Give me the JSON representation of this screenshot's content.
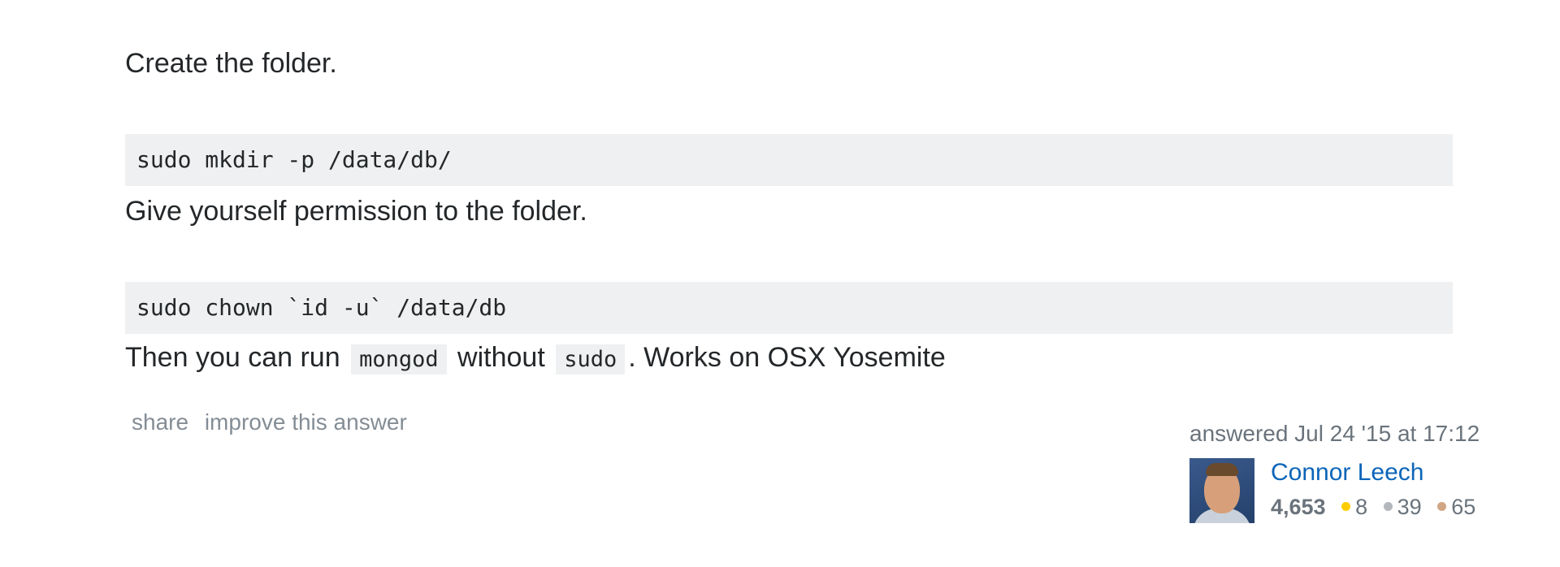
{
  "answer": {
    "paragraphs": {
      "p1": "Create the folder.",
      "p2": "Give yourself permission to the folder.",
      "p3_before": "Then you can run ",
      "p3_code1": "mongod",
      "p3_middle": " without ",
      "p3_code2": "sudo",
      "p3_after": ". Works on OSX Yosemite"
    },
    "code_blocks": {
      "block1": "sudo mkdir -p /data/db/",
      "block2": "sudo chown `id -u` /data/db"
    }
  },
  "post_menu": {
    "share_label": "share",
    "improve_label": "improve this answer"
  },
  "signature": {
    "answered_time": "answered Jul 24 '15 at 17:12",
    "user_name": "Connor Leech",
    "reputation": "4,653",
    "badges": {
      "gold": {
        "count": "8",
        "color": "#ffcc01"
      },
      "silver": {
        "count": "39",
        "color": "#b4b8bc"
      },
      "bronze": {
        "count": "65",
        "color": "#d1a684"
      }
    }
  },
  "icons": {
    "avatar": "user-avatar-photo"
  }
}
